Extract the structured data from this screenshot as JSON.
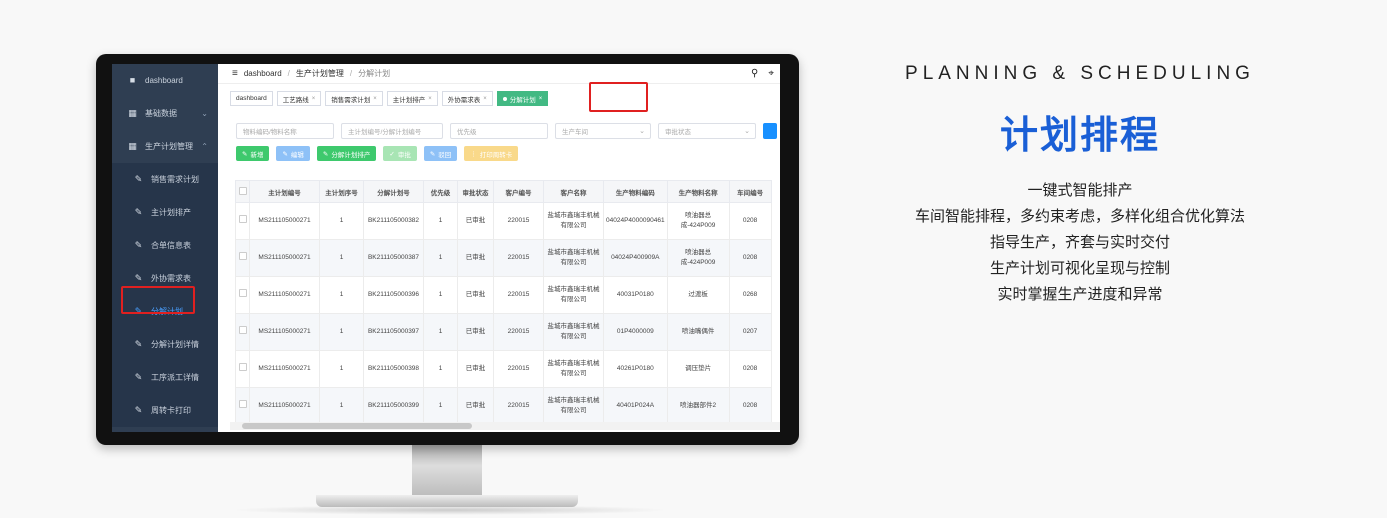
{
  "heading": {
    "english": "PLANNING & SCHEDULING",
    "chinese": "计划排程",
    "lines": [
      "一键式智能排产",
      "车间智能排程，多约束考虑，多样化组合优化算法",
      "指导生产，齐套与实时交付",
      "生产计划可视化呈现与控制",
      "实时掌握生产进度和异常"
    ]
  },
  "sidebar": {
    "items": [
      {
        "label": "dashboard",
        "icon": "dashboard-icon"
      },
      {
        "label": "基础数据",
        "icon": "grid-icon"
      },
      {
        "label": "生产计划管理",
        "icon": "grid-icon"
      },
      {
        "label": "销售需求计划",
        "icon": "edit-icon"
      },
      {
        "label": "主计划排产",
        "icon": "edit-icon"
      },
      {
        "label": "合单信息表",
        "icon": "edit-icon"
      },
      {
        "label": "外协需求表",
        "icon": "edit-icon"
      },
      {
        "label": "分解计划",
        "icon": "edit-icon"
      },
      {
        "label": "分解计划详情",
        "icon": "edit-icon"
      },
      {
        "label": "工序派工详情",
        "icon": "edit-icon"
      },
      {
        "label": "周转卡打印",
        "icon": "edit-icon"
      }
    ]
  },
  "breadcrumb": [
    "dashboard",
    "生产计划管理",
    "分解计划"
  ],
  "tabs": [
    {
      "label": "dashboard"
    },
    {
      "label": "工艺路线"
    },
    {
      "label": "销售需求计划"
    },
    {
      "label": "主计划排产"
    },
    {
      "label": "外协需求表"
    },
    {
      "label": "分解计划"
    }
  ],
  "filters": {
    "material": "物料编码/物料名称",
    "plan": "主计划编号/分解计划编号",
    "priority": "优先级",
    "workshop": "生产车间",
    "status": "审批状态"
  },
  "actions": {
    "add": "新增",
    "edit": "编辑",
    "split": "分解计划排产",
    "approve": "审批",
    "reject": "驳回",
    "print": "打印周转卡"
  },
  "table": {
    "headers": [
      "主计划编号",
      "主计划序号",
      "分解计划号",
      "优先级",
      "审批状态",
      "客户编号",
      "客户名称",
      "生产物料编码",
      "生产物料名称",
      "车间编号"
    ],
    "rows": [
      [
        "MS211105000271",
        "1",
        "BK211105000382",
        "1",
        "已审批",
        "220015",
        "盐城市鑫瑞丰机械有限公司",
        "04024P4000090461",
        "喷油器总成-424P009",
        "0208"
      ],
      [
        "MS211105000271",
        "1",
        "BK211105000387",
        "1",
        "已审批",
        "220015",
        "盐城市鑫瑞丰机械有限公司",
        "04024P400909A",
        "喷油器总成-424P009",
        "0208"
      ],
      [
        "MS211105000271",
        "1",
        "BK211105000396",
        "1",
        "已审批",
        "220015",
        "盐城市鑫瑞丰机械有限公司",
        "40031P0180",
        "过渡板",
        "0268"
      ],
      [
        "MS211105000271",
        "1",
        "BK211105000397",
        "1",
        "已审批",
        "220015",
        "盐城市鑫瑞丰机械有限公司",
        "01P4000009",
        "喷油嘴偶件",
        "0207"
      ],
      [
        "MS211105000271",
        "1",
        "BK211105000398",
        "1",
        "已审批",
        "220015",
        "盐城市鑫瑞丰机械有限公司",
        "40261P0180",
        "调压垫片",
        "0208"
      ],
      [
        "MS211105000271",
        "1",
        "BK211105000399",
        "1",
        "已审批",
        "220015",
        "盐城市鑫瑞丰机械有限公司",
        "40401P024A",
        "喷油器部件2",
        "0208"
      ]
    ]
  },
  "colors": {
    "sidebar_bg": "#2f3e52",
    "accent_blue": "#1a5fd6",
    "active_tab": "#42b983",
    "highlight_red": "#e02020"
  }
}
